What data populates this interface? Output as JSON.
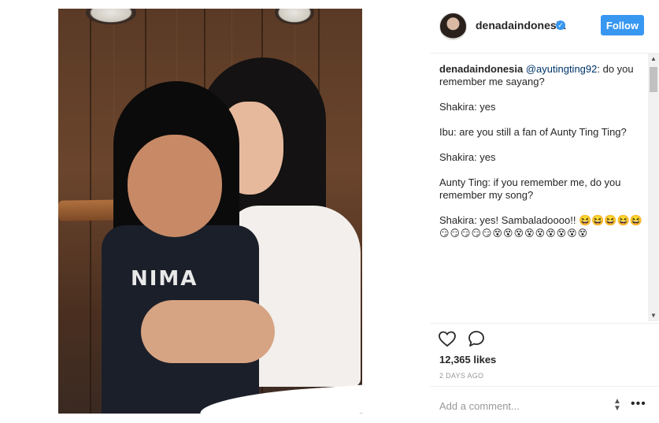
{
  "post": {
    "username": "denadaindonesia",
    "follow_label": "Follow",
    "verified_mark": "✓",
    "shirt_text": "NIMA"
  },
  "comments": [
    {
      "user": "denadaindonesia",
      "mention": "@ayutingting92",
      "text": ": do you remember me sayang?"
    },
    {
      "text": "Shakira: yes"
    },
    {
      "text": "Ibu: are you still a fan of Aunty Ting Ting?"
    },
    {
      "text": "Shakira: yes"
    },
    {
      "text": "Aunty Ting: if you remember me, do you remember my song?"
    },
    {
      "text": "Shakira: yes! Sambaladoooo!! 😆😆😆😆😆",
      "emoji_line": "😏😏😏😏😏😵😵😵😵😵😵😵😵😵"
    }
  ],
  "actions": {
    "like_icon": "heart-icon",
    "comment_icon": "comment-bubble-icon"
  },
  "likes": "12,365 likes",
  "timestamp": "2 DAYS AGO",
  "comment_input": {
    "placeholder": "Add a comment..."
  },
  "colors": {
    "accent": "#3897f0",
    "mention": "#003569",
    "muted": "#999999"
  }
}
